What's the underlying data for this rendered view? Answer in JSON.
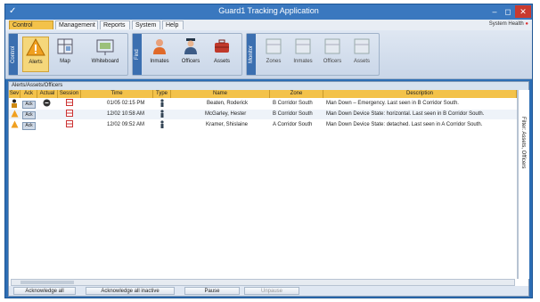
{
  "window": {
    "title": "Guard1 Tracking Application",
    "minimize": "–",
    "maximize": "◻",
    "close": "✕"
  },
  "menu": {
    "tabs": [
      "Control Room",
      "Management",
      "Reports",
      "System",
      "Help"
    ],
    "status": "System Health"
  },
  "ribbon": {
    "groups": [
      {
        "label": "Control",
        "buttons": [
          "Alerts",
          "Map",
          "Whiteboard"
        ]
      },
      {
        "label": "Find",
        "buttons": [
          "Inmates",
          "Officers",
          "Assets"
        ]
      },
      {
        "label": "Monitor",
        "buttons": [
          "Zones",
          "Inmates",
          "Officers",
          "Assets"
        ]
      }
    ]
  },
  "grid": {
    "panel_title": "Alerts/Assets/Officers",
    "columns": [
      "Sev",
      "Ack",
      "Actual",
      "Session",
      "Time",
      "Type",
      "Name",
      "Zone",
      "Description"
    ],
    "rows": [
      {
        "ack": "Ack",
        "time": "01/05 02:15 PM",
        "name": "Beaten, Roderick",
        "zone": "B Corridor South",
        "description": "Man Down – Emergency. Last seen in B Corridor South."
      },
      {
        "ack": "Ack",
        "time": "12/02 10:58 AM",
        "name": "McGarley, Hester",
        "zone": "B Corridor South",
        "description": "Man Down Device State: horizontal. Last seen in B Corridor South."
      },
      {
        "ack": "Ack",
        "time": "12/02 09:52 AM",
        "name": "Kramer, Shislaine",
        "zone": "A Corridor South",
        "description": "Man Down Device State: detached. Last seen in A Corridor South."
      }
    ],
    "sidebar_label": "Filter: Assets, Officers"
  },
  "footer": {
    "buttons": [
      "Acknowledge all",
      "Acknowledge all inactive",
      "Pause",
      "Unpause"
    ]
  },
  "colors": {
    "accent": "#f3c24a",
    "titlebar": "#3a78bf",
    "close": "#c93a2e"
  }
}
